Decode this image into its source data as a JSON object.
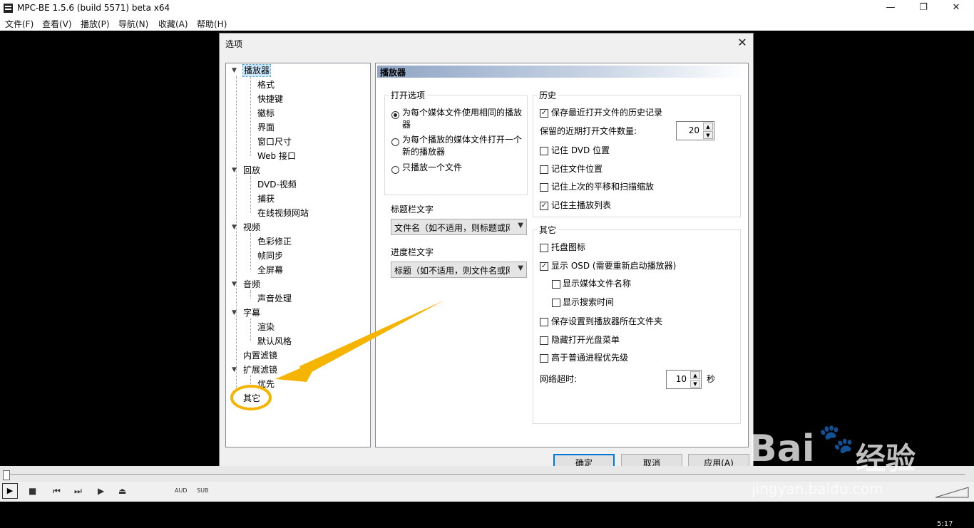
{
  "app": {
    "title": "MPC-BE 1.5.6 (build 5571) beta x64",
    "menu": [
      "文件(F)",
      "查看(V)",
      "播放(P)",
      "导航(N)",
      "收藏(A)",
      "帮助(H)"
    ]
  },
  "dialog": {
    "title": "选项",
    "tree": [
      {
        "label": "播放器",
        "expanded": true,
        "selected": true,
        "children": [
          "格式",
          "快捷键",
          "徽标",
          "界面",
          "窗口尺寸",
          "Web 接口"
        ]
      },
      {
        "label": "回放",
        "expanded": true,
        "children": [
          "DVD-视频",
          "捕获",
          "在线视频网站"
        ]
      },
      {
        "label": "视频",
        "expanded": true,
        "children": [
          "色彩修正",
          "帧同步",
          "全屏幕"
        ]
      },
      {
        "label": "音频",
        "expanded": true,
        "children": [
          "声音处理"
        ]
      },
      {
        "label": "字幕",
        "expanded": true,
        "children": [
          "渲染",
          "默认风格"
        ]
      },
      {
        "label": "内置滤镜",
        "children": []
      },
      {
        "label": "扩展滤镜",
        "expanded": true,
        "children": [
          "优先"
        ]
      },
      {
        "label": "其它",
        "children": []
      }
    ],
    "panel": {
      "header": "播放器",
      "open_options": {
        "label": "打开选项",
        "radios": [
          {
            "line1": "为每个媒体文件使用相同的播放",
            "line2": "器",
            "checked": true
          },
          {
            "line1": "为每个播放的媒体文件打开一个",
            "line2": "新的播放器",
            "checked": false
          },
          {
            "line1": "只播放一个文件",
            "line2": "",
            "checked": false
          }
        ]
      },
      "titlebar_text": {
        "label": "标题栏文字",
        "value": "文件名（如不适用，则标题或网"
      },
      "seekbar_text": {
        "label": "进度栏文字",
        "value": "标题（如不适用，则文件名或网"
      },
      "history": {
        "label": "历史",
        "save_recent": {
          "label": "保存最近打开文件的历史记录",
          "checked": true
        },
        "recent_count": {
          "label": "保留的近期打开文件数量:",
          "value": "20"
        },
        "remember_dvd": {
          "label": "记住 DVD 位置",
          "checked": false
        },
        "remember_file": {
          "label": "记住文件位置",
          "checked": false
        },
        "remember_pan": {
          "label": "记住上次的平移和扫描缩放",
          "checked": false
        },
        "remember_playlist": {
          "label": "记住主播放列表",
          "checked": true
        }
      },
      "other": {
        "label": "其它",
        "tray_icon": {
          "label": "托盘图标",
          "checked": false
        },
        "show_osd": {
          "label": "显示 OSD (需要重新启动播放器)",
          "checked": true
        },
        "show_filename": {
          "label": "显示媒体文件名称",
          "checked": false
        },
        "show_seek_time": {
          "label": "显示搜索时间",
          "checked": false
        },
        "save_settings": {
          "label": "保存设置到播放器所在文件夹",
          "checked": false
        },
        "hide_cdrom": {
          "label": "隐藏打开光盘菜单",
          "checked": false
        },
        "high_priority": {
          "label": "高于普通进程优先级",
          "checked": false
        },
        "timeout": {
          "label": "网络超时:",
          "value": "10",
          "unit": "秒"
        }
      }
    },
    "buttons": {
      "ok": "确定",
      "cancel": "取消",
      "apply": "应用(A)"
    }
  },
  "player": {
    "aud": "AUD",
    "sub": "SUB",
    "time": "5:17"
  },
  "watermark": {
    "brand": "Bai",
    "brand2": "经验",
    "url": "jingyan.baidu.com"
  },
  "colors": {
    "accent": "#0078d7",
    "annotation": "#f5b400",
    "selection": "#cce8ff"
  }
}
